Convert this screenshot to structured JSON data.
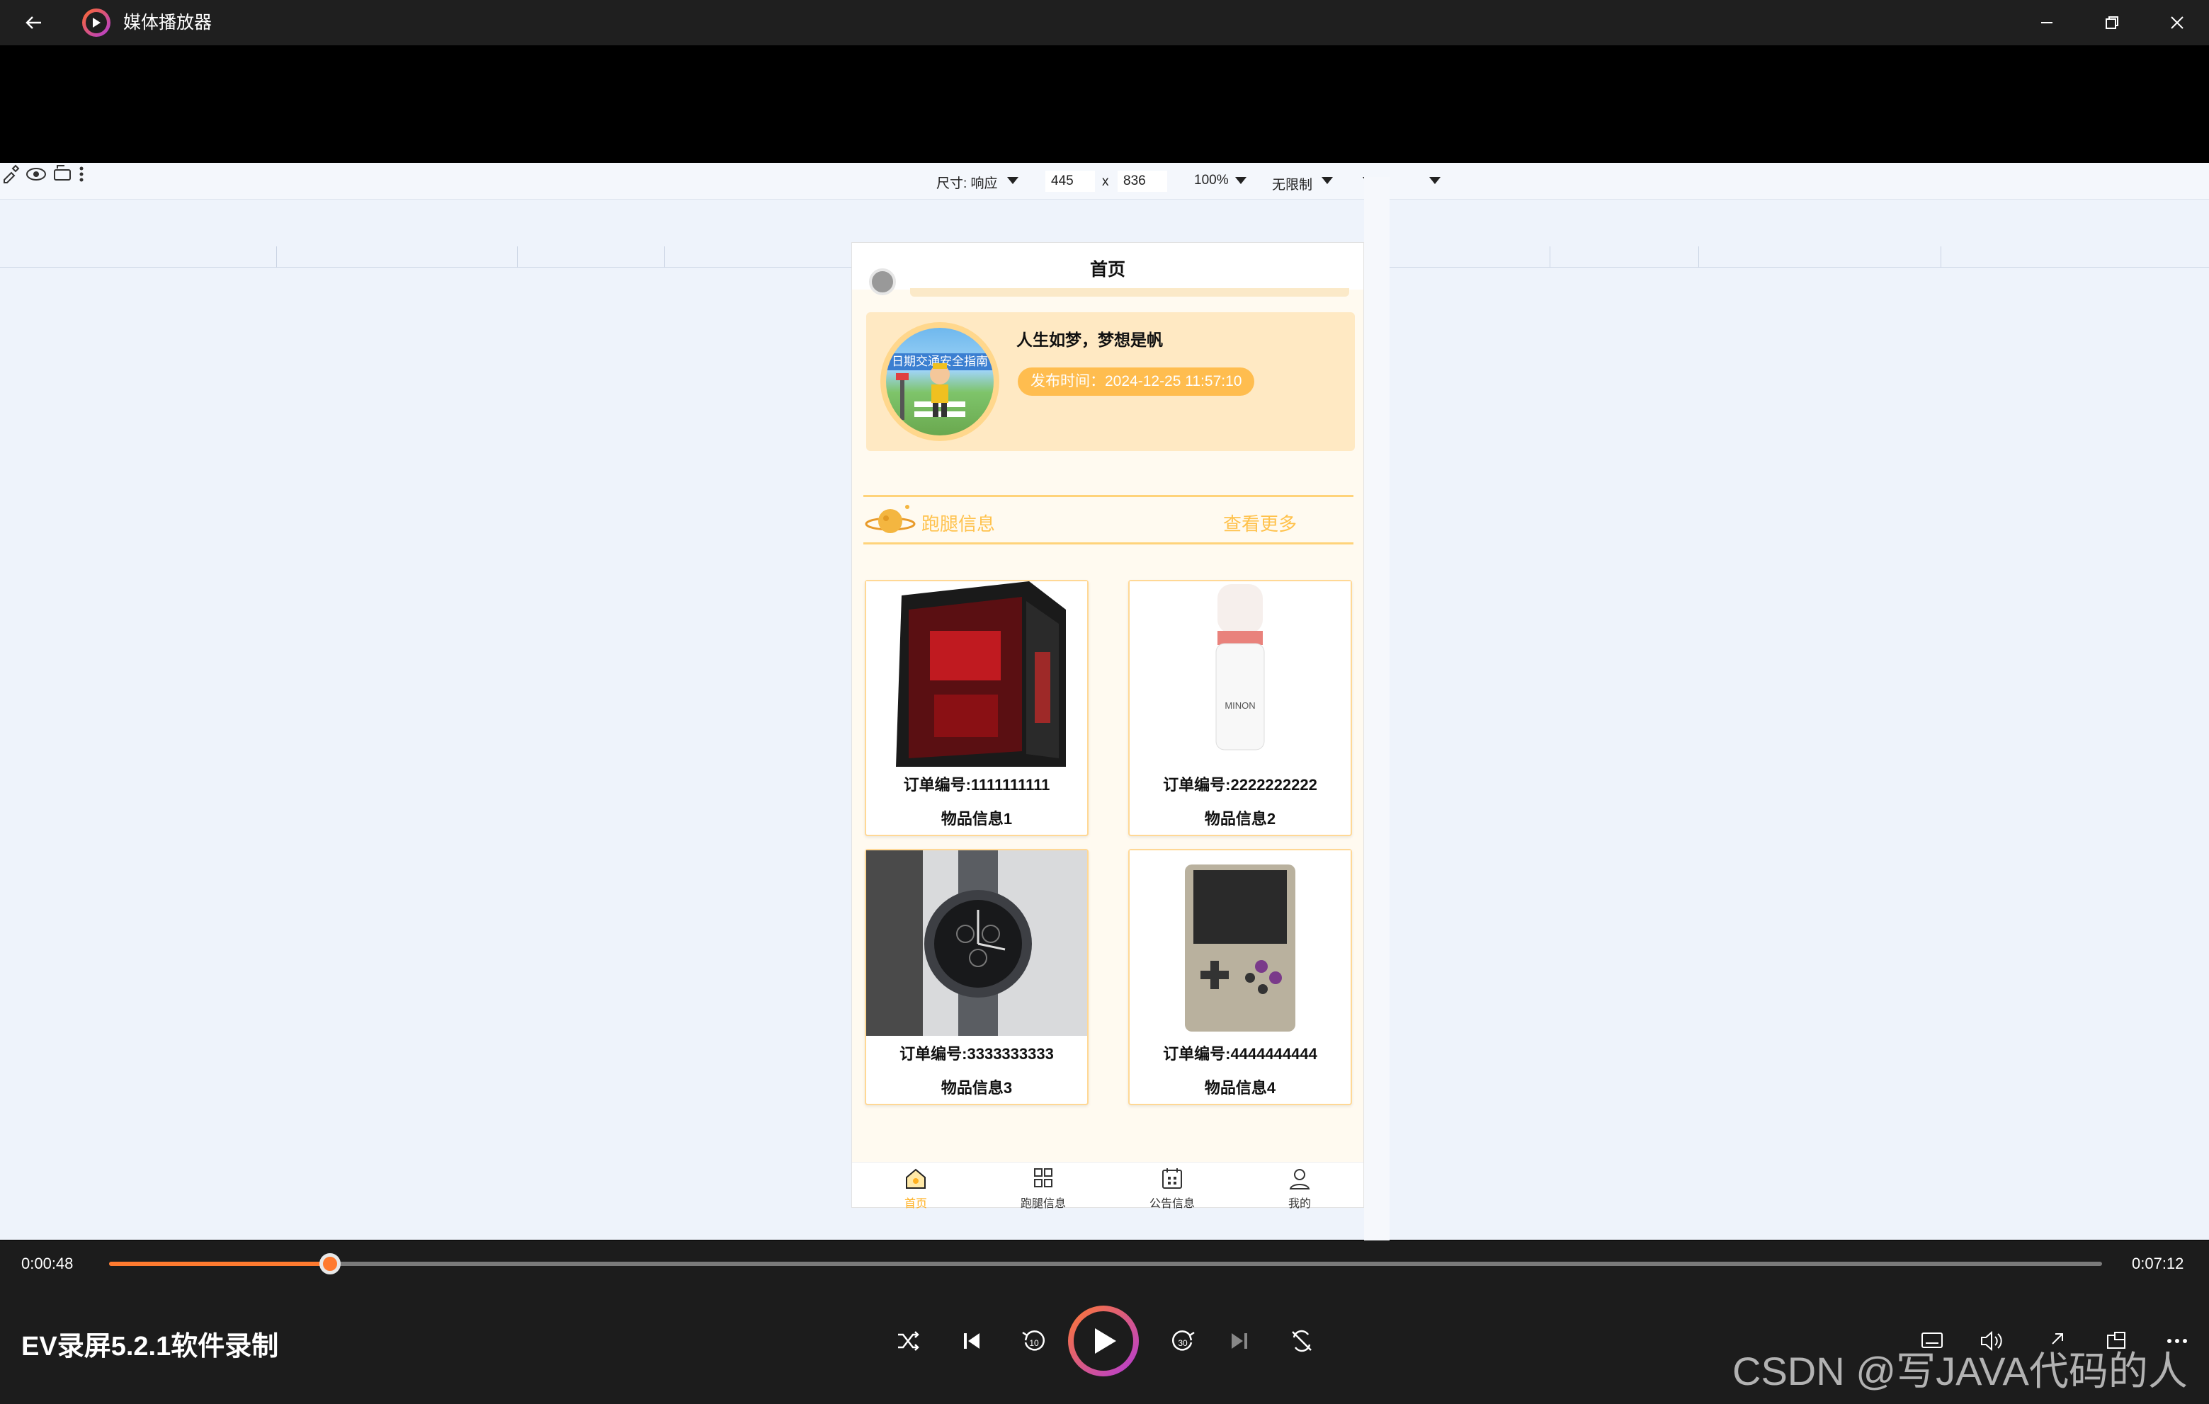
{
  "window": {
    "app_title": "媒体播放器"
  },
  "devtools": {
    "size_label": "尺寸: 响应",
    "width": "445",
    "times": "x",
    "height": "836",
    "zoom": "100%",
    "throttle": "无限制"
  },
  "phone": {
    "page_title": "首页",
    "notice": {
      "image_caption": "日期交通安全指南",
      "title": "人生如梦，梦想是帆",
      "time": "发布时间：2024-12-25 11:57:10"
    },
    "section": {
      "title": "跑腿信息",
      "more": "查看更多"
    },
    "items": [
      {
        "order": "订单编号:1111111111",
        "goods": "物品信息1"
      },
      {
        "order": "订单编号:2222222222",
        "goods": "物品信息2"
      },
      {
        "order": "订单编号:3333333333",
        "goods": "物品信息3"
      },
      {
        "order": "订单编号:4444444444",
        "goods": "物品信息4"
      }
    ],
    "tabs": [
      {
        "label": "首页",
        "icon": "home-icon"
      },
      {
        "label": "跑腿信息",
        "icon": "grid-icon"
      },
      {
        "label": "公告信息",
        "icon": "calendar-icon"
      },
      {
        "label": "我的",
        "icon": "user-icon"
      }
    ],
    "active_color": "#ffb020"
  },
  "player": {
    "current_time": "0:00:48",
    "total_time": "0:07:12",
    "progress_fraction": 0.111,
    "video_title": "EV录屏5.2.1软件录制",
    "accent": "#ff7a2f"
  },
  "watermark": "CSDN @写JAVA代码的人"
}
